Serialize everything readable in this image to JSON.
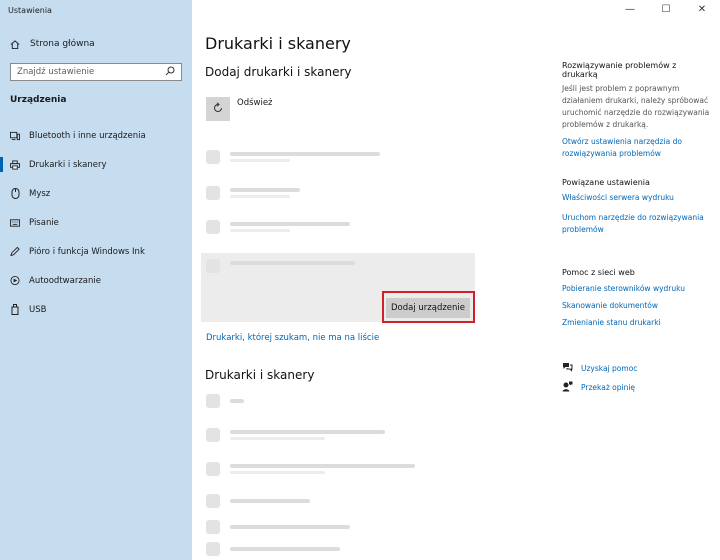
{
  "window": {
    "title": "Ustawienia",
    "minimize": "—",
    "maximize": "☐",
    "close": "✕"
  },
  "sidebar": {
    "home": {
      "label": "Strona główna",
      "icon": "home-icon"
    },
    "search": {
      "placeholder": "Znajdź ustawienie",
      "icon": "search-icon"
    },
    "section_title": "Urządzenia",
    "items": [
      {
        "label": "Bluetooth i inne urządzenia",
        "icon": "bluetooth-devices-icon",
        "active": false
      },
      {
        "label": "Drukarki i skanery",
        "icon": "printer-icon",
        "active": true
      },
      {
        "label": "Mysz",
        "icon": "mouse-icon",
        "active": false
      },
      {
        "label": "Pisanie",
        "icon": "keyboard-icon",
        "active": false
      },
      {
        "label": "Pióro i funkcja Windows Ink",
        "icon": "pen-icon",
        "active": false
      },
      {
        "label": "Autoodtwarzanie",
        "icon": "autoplay-icon",
        "active": false
      },
      {
        "label": "USB",
        "icon": "usb-icon",
        "active": false
      }
    ]
  },
  "main": {
    "title": "Drukarki i skanery",
    "add_section_title": "Dodaj drukarki i skanery",
    "refresh_label": "Odśwież",
    "add_device_button": "Dodaj urządzenie",
    "not_listed_link": "Drukarki, której szukam, nie ma na liście",
    "printers_section_title": "Drukarki i skanery"
  },
  "right_panel": {
    "troubleshoot": {
      "title": "Rozwiązywanie problemów z drukarką",
      "text": "Jeśli jest problem z poprawnym działaniem drukarki, należy spróbować uruchomić narzędzie do rozwiązywania problemów z drukarką.",
      "link": "Otwórz ustawienia narzędzia do rozwiązywania problemów"
    },
    "related": {
      "title": "Powiązane ustawienia",
      "links": [
        "Właściwości serwera wydruku",
        "Uruchom narzędzie do rozwiązywania problemów"
      ]
    },
    "help": {
      "title": "Pomoc z sieci web",
      "links": [
        "Pobieranie sterowników wydruku",
        "Skanowanie dokumentów",
        "Zmienianie stanu drukarki"
      ]
    },
    "get_help": "Uzyskaj pomoc",
    "feedback": "Przekaż opinię"
  },
  "colors": {
    "sidebar_bg": "#c6ddf0",
    "accent": "#0063b1",
    "link": "#0067b8",
    "highlight_outline": "#d21f2a"
  }
}
